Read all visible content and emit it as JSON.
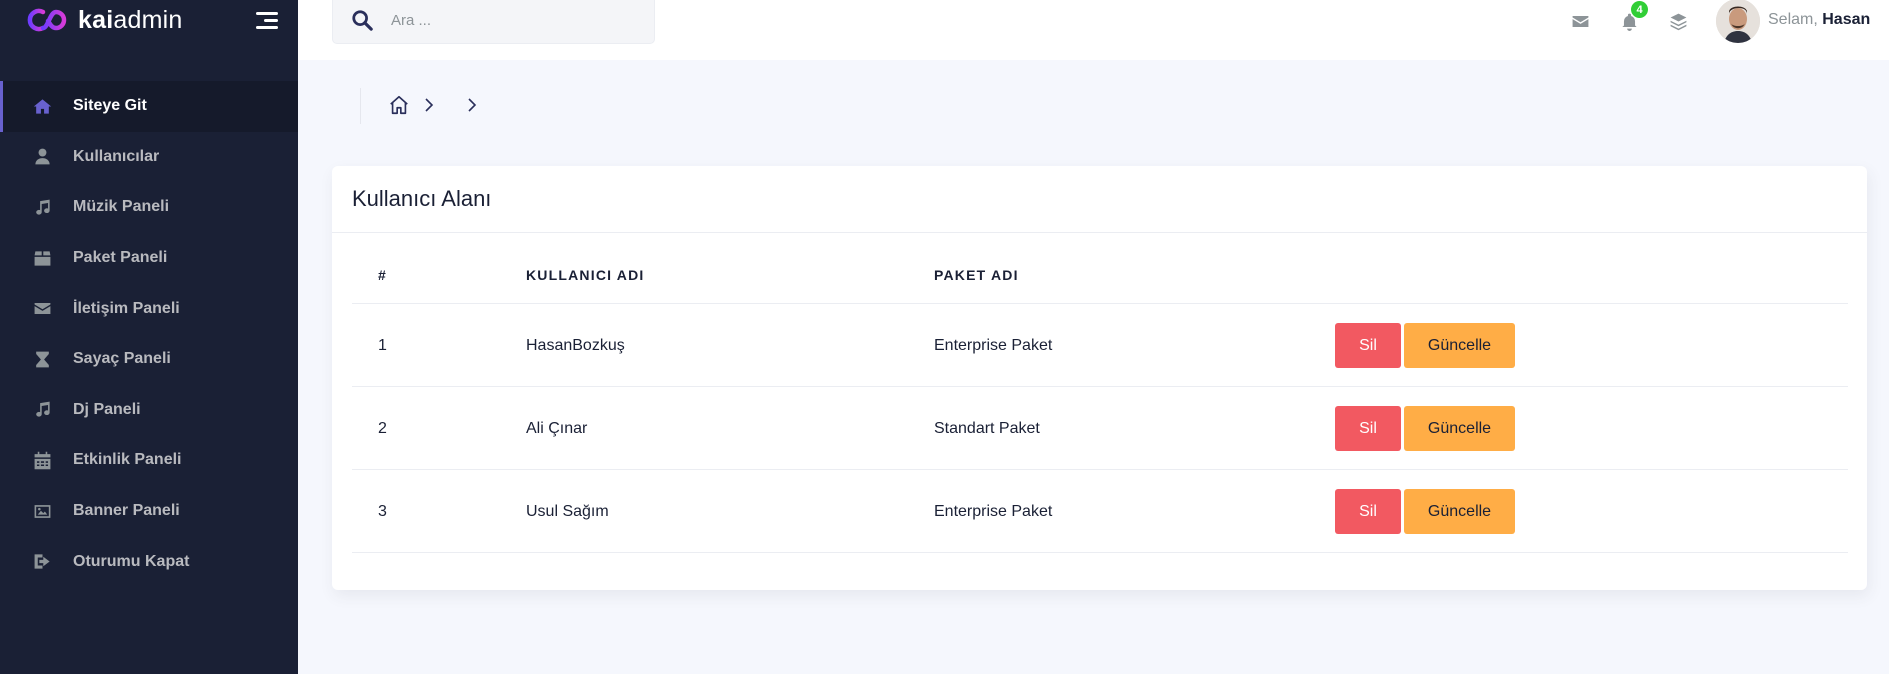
{
  "brand": {
    "bold": "kai",
    "regular": "admin",
    "accent": "#6861ce"
  },
  "sidebar": {
    "items": [
      {
        "label": "Siteye Git",
        "icon": "home-icon",
        "active": true
      },
      {
        "label": "Kullanıcılar",
        "icon": "user-icon"
      },
      {
        "label": "Müzik Paneli",
        "icon": "music-icon"
      },
      {
        "label": "Paket Paneli",
        "icon": "box-icon"
      },
      {
        "label": "İletişim Paneli",
        "icon": "envelope-icon"
      },
      {
        "label": "Sayaç Paneli",
        "icon": "hourglass-icon"
      },
      {
        "label": "Dj Paneli",
        "icon": "music-icon"
      },
      {
        "label": "Etkinlik Paneli",
        "icon": "calendar-icon"
      },
      {
        "label": "Banner Paneli",
        "icon": "image-icon"
      },
      {
        "label": "Oturumu Kapat",
        "icon": "sign-out-icon"
      }
    ]
  },
  "header": {
    "search_placeholder": "Ara ...",
    "notification_count": "4",
    "greeting": "Selam,",
    "user_name": "Hasan"
  },
  "card": {
    "title": "Kullanıcı Alanı",
    "columns": [
      "#",
      "KULLANICI ADI",
      "PAKET ADI"
    ],
    "rows": [
      {
        "id": "1",
        "username": "HasanBozkuş",
        "package": "Enterprise Paket"
      },
      {
        "id": "2",
        "username": "Ali Çınar",
        "package": "Standart Paket"
      },
      {
        "id": "3",
        "username": "Usul Sağım",
        "package": "Enterprise Paket"
      }
    ],
    "delete_label": "Sil",
    "update_label": "Güncelle"
  },
  "colors": {
    "sidebar_bg": "#1a2035",
    "danger": "#f25961",
    "warning": "#ffad46",
    "badge": "#31ce36"
  }
}
